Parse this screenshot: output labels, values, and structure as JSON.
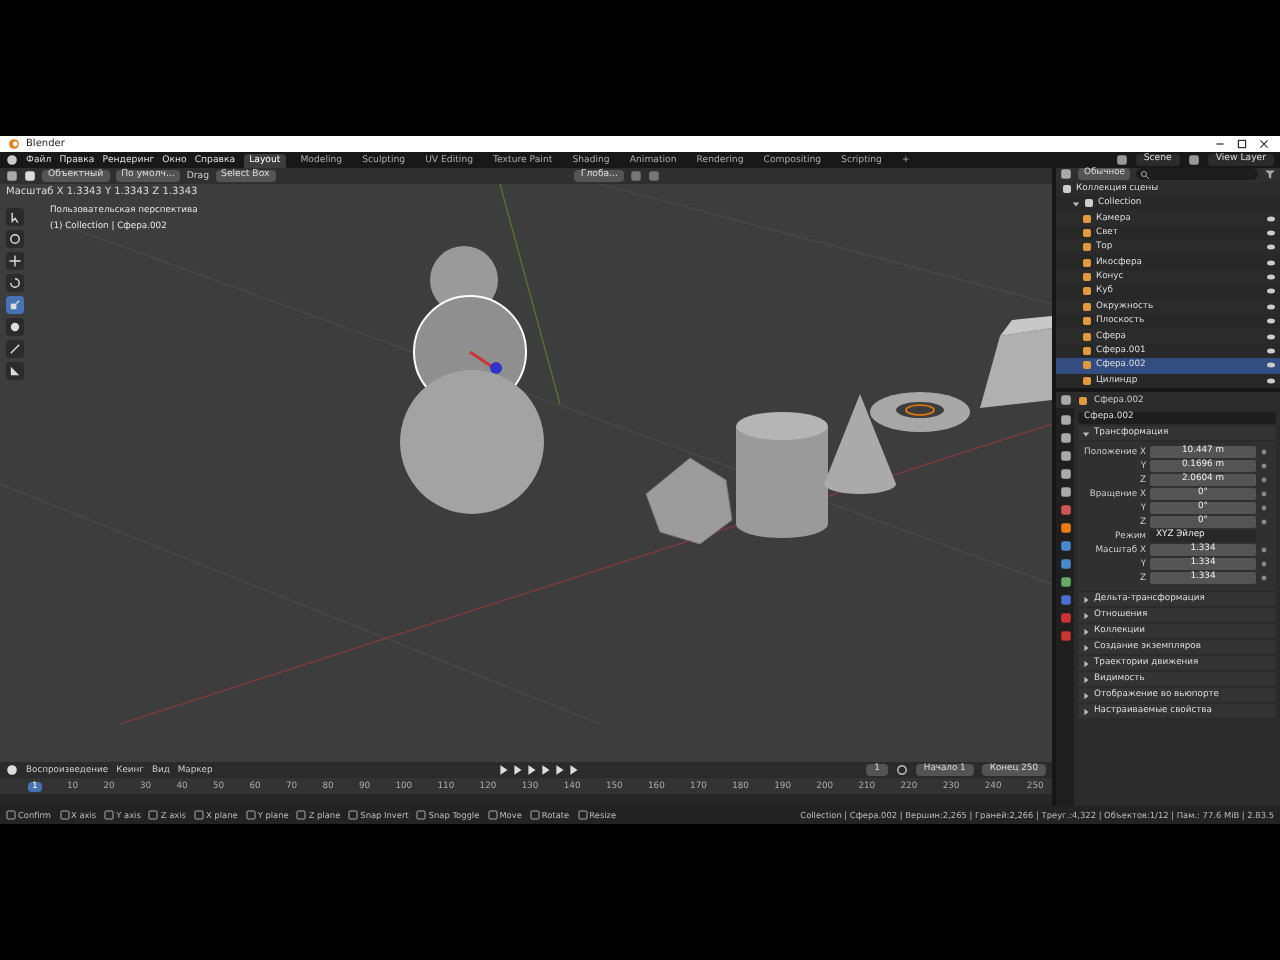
{
  "window": {
    "title": "Blender"
  },
  "menu": [
    "Файл",
    "Правка",
    "Рендеринг",
    "Окно",
    "Справка"
  ],
  "workspaces": [
    {
      "label": "Layout",
      "selected": true
    },
    {
      "label": "Modeling",
      "selected": false
    },
    {
      "label": "Sculpting",
      "selected": false
    },
    {
      "label": "UV Editing",
      "selected": false
    },
    {
      "label": "Texture Paint",
      "selected": false
    },
    {
      "label": "Shading",
      "selected": false
    },
    {
      "label": "Animation",
      "selected": false
    },
    {
      "label": "Rendering",
      "selected": false
    },
    {
      "label": "Compositing",
      "selected": false
    },
    {
      "label": "Scripting",
      "selected": false
    },
    {
      "label": "+",
      "selected": false
    }
  ],
  "scene": "Scene",
  "view_layer": "View Layer",
  "header": {
    "mode": "Объектный",
    "orientation": "По умолч...",
    "drag_label": "Drag",
    "drag_value": "Select Box",
    "transform_space": "Глоба..."
  },
  "viewport": {
    "operator_status": "Масштаб X 1.3343  Y 1.3343  Z 1.3343",
    "view_name": "Пользовательская перспектива",
    "object_info": "(1) Collection | Сфера.002"
  },
  "tools": [
    {
      "kind": "select",
      "selected": false
    },
    {
      "kind": "cursor",
      "selected": false
    },
    {
      "kind": "move",
      "selected": false
    },
    {
      "kind": "rotate",
      "selected": false
    },
    {
      "kind": "scale",
      "selected": true
    },
    {
      "kind": "transform",
      "selected": false
    },
    {
      "kind": "annotate",
      "selected": false
    },
    {
      "kind": "measure",
      "selected": false
    }
  ],
  "outliner": {
    "display_mode": "Обычное",
    "root": "Коллекция сцены",
    "items": [
      {
        "label": "Collection",
        "expanded": true,
        "children": [
          {
            "label": "Камера",
            "selected": false
          },
          {
            "label": "Свет",
            "selected": false
          },
          {
            "label": "Тор",
            "selected": false
          },
          {
            "label": "Икосфера",
            "selected": false
          },
          {
            "label": "Конус",
            "selected": false
          },
          {
            "label": "Куб",
            "selected": false
          },
          {
            "label": "Окружность",
            "selected": false
          },
          {
            "label": "Плоскость",
            "selected": false
          },
          {
            "label": "Сфера",
            "selected": false
          },
          {
            "label": "Сфера.001",
            "selected": false
          },
          {
            "label": "Сфера.002",
            "selected": true
          },
          {
            "label": "Цилиндр",
            "selected": false
          }
        ]
      }
    ]
  },
  "properties": {
    "context": "Сфера.002",
    "object_name": "Сфера.002",
    "sections": [
      {
        "title": "Трансформация",
        "expanded": true
      },
      {
        "title": "Дельта-трансформация",
        "expanded": false
      },
      {
        "title": "Отношения",
        "expanded": false
      },
      {
        "title": "Коллекции",
        "expanded": false
      },
      {
        "title": "Создание экземпляров",
        "expanded": false
      },
      {
        "title": "Траектории движения",
        "expanded": false
      },
      {
        "title": "Видимость",
        "expanded": false
      },
      {
        "title": "Отображение во вьюпорте",
        "expanded": false
      },
      {
        "title": "Настраиваемые свойства",
        "expanded": false
      }
    ],
    "transform": [
      {
        "label": "Положение X",
        "value": "10.447 m"
      },
      {
        "label": "Y",
        "value": "0.1696 m"
      },
      {
        "label": "Z",
        "value": "2.0604 m"
      },
      {
        "label": "Вращение X",
        "value": "0°"
      },
      {
        "label": "Y",
        "value": "0°"
      },
      {
        "label": "Z",
        "value": "0°"
      },
      {
        "label": "Режим",
        "value": "XYZ Эйлер",
        "kind": "dropdown"
      },
      {
        "label": "Масштаб X",
        "value": "1.334"
      },
      {
        "label": "Y",
        "value": "1.334"
      },
      {
        "label": "Z",
        "value": "1.334"
      }
    ]
  },
  "timeline": {
    "menus": [
      "Воспроизведение",
      "Кеинг",
      "Вид",
      "Маркер"
    ],
    "current_frame": "1",
    "start_label": "Начало",
    "start": "1",
    "end_label": "Конец",
    "end": "250",
    "ticks": [
      "1",
      "10",
      "20",
      "30",
      "40",
      "50",
      "60",
      "70",
      "80",
      "90",
      "100",
      "110",
      "120",
      "130",
      "140",
      "150",
      "160",
      "170",
      "180",
      "190",
      "200",
      "210",
      "220",
      "230",
      "240",
      "250"
    ]
  },
  "status_bar": {
    "hints": [
      "Confirm",
      "X axis",
      "Y axis",
      "Z axis",
      "X plane",
      "Y plane",
      "Z plane",
      "Snap Invert",
      "Snap Toggle",
      "Move",
      "Rotate",
      "Resize"
    ],
    "info": "Collection | Сфера.002 | Вершин:2,265 | Граней:2,266 | Треуг.:4,322 | Объектов:1/12 | Пам.: 77.6 MiB | 2.83.5"
  }
}
